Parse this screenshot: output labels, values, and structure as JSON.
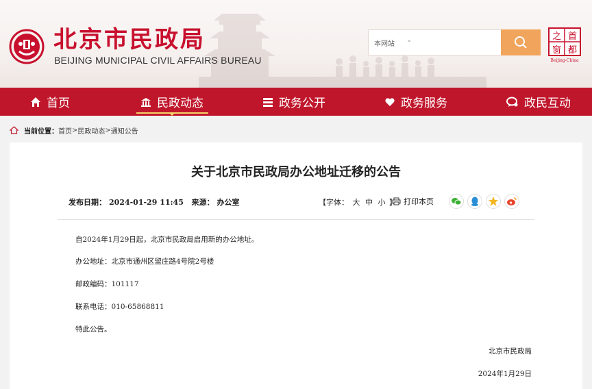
{
  "header": {
    "title": "北京市民政局",
    "subtitle": "BEIJING MUNICIPAL CIVIL AFFAIRS BUREAU",
    "capital_logo_text": "首都之窗",
    "capital_logo_sub": "Beijing-China"
  },
  "search": {
    "scope": "本网站",
    "placeholder": ""
  },
  "nav": {
    "items": [
      {
        "label": "首页",
        "icon": "home-icon"
      },
      {
        "label": "民政动态",
        "icon": "building-icon"
      },
      {
        "label": "政务公开",
        "icon": "document-icon"
      },
      {
        "label": "政务服务",
        "icon": "heart-icon"
      },
      {
        "label": "政民互动",
        "icon": "chat-icon"
      }
    ],
    "active_index": 1
  },
  "breadcrumb": {
    "label": "当前位置：",
    "items": [
      "首页",
      "民政动态",
      "通知公告"
    ],
    "separator": ">"
  },
  "article": {
    "title": "关于北京市民政局办公地址迁移的公告",
    "date_label": "发布日期：",
    "date": "2024-01-29 11:45",
    "source_label": "来源：",
    "source": "办公室",
    "font_label_open": "【字体：",
    "font_large": "大",
    "font_medium": "中",
    "font_small": "小",
    "font_label_close": "】",
    "print_label": "打印本页",
    "paragraphs": [
      "自2024年1月29日起，北京市民政局启用新的办公地址。",
      "办公地址：北京市通州区留庄路4号院2号楼",
      "邮政编码：101117",
      "联系电话：010-65868811",
      "特此公告。"
    ],
    "signature": "北京市民政局",
    "sign_date": "2024年1月29日"
  },
  "share": [
    "wechat-icon",
    "qq-icon",
    "qzone-icon",
    "weibo-icon"
  ],
  "colors": {
    "brand_red": "#c0162b",
    "accent_orange": "#f0a45c",
    "active_underline": "#f5d46a"
  }
}
